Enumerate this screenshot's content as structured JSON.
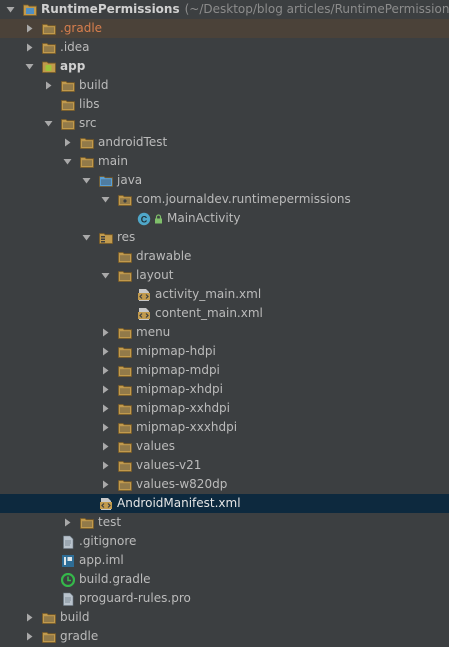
{
  "project": {
    "name": "RuntimePermissions",
    "path": "(~/Desktop/blog articles/RuntimePermissions)"
  },
  "tree": [
    {
      "label": "RuntimePermissions",
      "suffix": "(~/Desktop/blog articles/RuntimePermissions)",
      "depth": 0,
      "arrow": "down",
      "icon": "project-module-icon",
      "style": "bold",
      "row": "normal"
    },
    {
      "label": ".gradle",
      "depth": 1,
      "arrow": "right",
      "icon": "folder-icon",
      "style": "excl",
      "row": "hl"
    },
    {
      "label": ".idea",
      "depth": 1,
      "arrow": "right",
      "icon": "folder-icon",
      "style": "normal",
      "row": "normal"
    },
    {
      "label": "app",
      "depth": 1,
      "arrow": "down",
      "icon": "android-module-icon",
      "style": "bold",
      "row": "normal"
    },
    {
      "label": "build",
      "depth": 2,
      "arrow": "right",
      "icon": "folder-icon",
      "style": "normal",
      "row": "normal"
    },
    {
      "label": "libs",
      "depth": 2,
      "arrow": "none",
      "icon": "folder-icon",
      "style": "normal",
      "row": "normal"
    },
    {
      "label": "src",
      "depth": 2,
      "arrow": "down",
      "icon": "folder-icon",
      "style": "normal",
      "row": "normal"
    },
    {
      "label": "androidTest",
      "depth": 3,
      "arrow": "right",
      "icon": "folder-icon",
      "style": "normal",
      "row": "normal"
    },
    {
      "label": "main",
      "depth": 3,
      "arrow": "down",
      "icon": "folder-icon",
      "style": "normal",
      "row": "normal"
    },
    {
      "label": "java",
      "depth": 4,
      "arrow": "down",
      "icon": "source-folder-icon",
      "style": "normal",
      "row": "normal"
    },
    {
      "label": "com.journaldev.runtimepermissions",
      "depth": 5,
      "arrow": "down",
      "icon": "package-icon",
      "style": "normal",
      "row": "normal"
    },
    {
      "label": "MainActivity",
      "depth": 6,
      "arrow": "none",
      "icon": "class-icon",
      "style": "normal",
      "row": "normal",
      "lock": true
    },
    {
      "label": "res",
      "depth": 4,
      "arrow": "down",
      "icon": "resource-folder-icon",
      "style": "normal",
      "row": "normal"
    },
    {
      "label": "drawable",
      "depth": 5,
      "arrow": "none",
      "icon": "folder-icon",
      "style": "normal",
      "row": "normal"
    },
    {
      "label": "layout",
      "depth": 5,
      "arrow": "down",
      "icon": "folder-icon",
      "style": "normal",
      "row": "normal"
    },
    {
      "label": "activity_main.xml",
      "depth": 6,
      "arrow": "none",
      "icon": "xml-file-icon",
      "style": "normal",
      "row": "normal"
    },
    {
      "label": "content_main.xml",
      "depth": 6,
      "arrow": "none",
      "icon": "xml-file-icon",
      "style": "normal",
      "row": "normal"
    },
    {
      "label": "menu",
      "depth": 5,
      "arrow": "right",
      "icon": "folder-icon",
      "style": "normal",
      "row": "normal"
    },
    {
      "label": "mipmap-hdpi",
      "depth": 5,
      "arrow": "right",
      "icon": "folder-icon",
      "style": "normal",
      "row": "normal"
    },
    {
      "label": "mipmap-mdpi",
      "depth": 5,
      "arrow": "right",
      "icon": "folder-icon",
      "style": "normal",
      "row": "normal"
    },
    {
      "label": "mipmap-xhdpi",
      "depth": 5,
      "arrow": "right",
      "icon": "folder-icon",
      "style": "normal",
      "row": "normal"
    },
    {
      "label": "mipmap-xxhdpi",
      "depth": 5,
      "arrow": "right",
      "icon": "folder-icon",
      "style": "normal",
      "row": "normal"
    },
    {
      "label": "mipmap-xxxhdpi",
      "depth": 5,
      "arrow": "right",
      "icon": "folder-icon",
      "style": "normal",
      "row": "normal"
    },
    {
      "label": "values",
      "depth": 5,
      "arrow": "right",
      "icon": "folder-icon",
      "style": "normal",
      "row": "normal"
    },
    {
      "label": "values-v21",
      "depth": 5,
      "arrow": "right",
      "icon": "folder-icon",
      "style": "normal",
      "row": "normal"
    },
    {
      "label": "values-w820dp",
      "depth": 5,
      "arrow": "right",
      "icon": "folder-icon",
      "style": "normal",
      "row": "normal"
    },
    {
      "label": "AndroidManifest.xml",
      "depth": 4,
      "arrow": "none",
      "icon": "manifest-file-icon",
      "style": "white",
      "row": "selected"
    },
    {
      "label": "test",
      "depth": 3,
      "arrow": "right",
      "icon": "folder-icon",
      "style": "normal",
      "row": "normal"
    },
    {
      "label": ".gitignore",
      "depth": 2,
      "arrow": "none",
      "icon": "text-file-icon",
      "style": "normal",
      "row": "normal"
    },
    {
      "label": "app.iml",
      "depth": 2,
      "arrow": "none",
      "icon": "iml-file-icon",
      "style": "normal",
      "row": "normal"
    },
    {
      "label": "build.gradle",
      "depth": 2,
      "arrow": "none",
      "icon": "gradle-file-icon",
      "style": "normal",
      "row": "normal"
    },
    {
      "label": "proguard-rules.pro",
      "depth": 2,
      "arrow": "none",
      "icon": "text-file-icon",
      "style": "normal",
      "row": "normal"
    },
    {
      "label": "build",
      "depth": 1,
      "arrow": "right",
      "icon": "folder-icon",
      "style": "normal",
      "row": "normal"
    },
    {
      "label": "gradle",
      "depth": 1,
      "arrow": "right",
      "icon": "folder-icon",
      "style": "normal",
      "row": "normal"
    }
  ],
  "colors": {
    "background": "#3c3f41",
    "text": "#bbbbbb",
    "excluded_text": "#d77e4d",
    "highlight_row": "#4b4239",
    "selected_row": "#0d293e",
    "folder": "#c19a4d",
    "source_folder": "#5a9fd4",
    "class_badge": "#4fa7c9",
    "gradle": "#35b84a"
  }
}
